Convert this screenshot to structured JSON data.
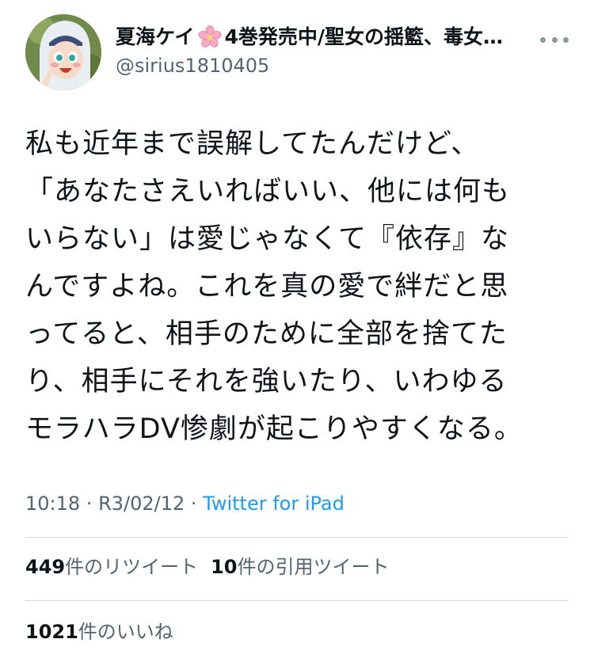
{
  "user": {
    "display_name": "夏海ケイ",
    "name_suffix": "4巻発売中/聖女の揺籃、毒女…",
    "handle": "@sirius1810405",
    "emoji_icon": "cherry-blossom-icon",
    "avatar_icon": "nun-avatar"
  },
  "tweet": {
    "lines": [
      "私も近年まで誤解してたんだけど、",
      "「あなたさえいればいい、他には何も",
      "いらない」は愛じゃなくて『依存』な",
      "んですよね。これを真の愛で絆だと思",
      "ってると、相手のために全部を捨てた",
      "り、相手にそれを強いたり、いわゆる",
      "モラハラDV惨劇が起こりやすくなる。"
    ]
  },
  "meta": {
    "time": "10:18",
    "separator": " · ",
    "date": "R3/02/12",
    "source": "Twitter for iPad"
  },
  "stats": {
    "retweets_count": "449",
    "retweets_label": "件のリツイート",
    "quotes_count": "10",
    "quotes_label": "件の引用ツイート",
    "likes_count": "1021",
    "likes_label": "件のいいね"
  },
  "colors": {
    "text": "#0f1419",
    "secondary": "#536471",
    "link": "#1d9bf0",
    "divider": "#cfd9de"
  }
}
